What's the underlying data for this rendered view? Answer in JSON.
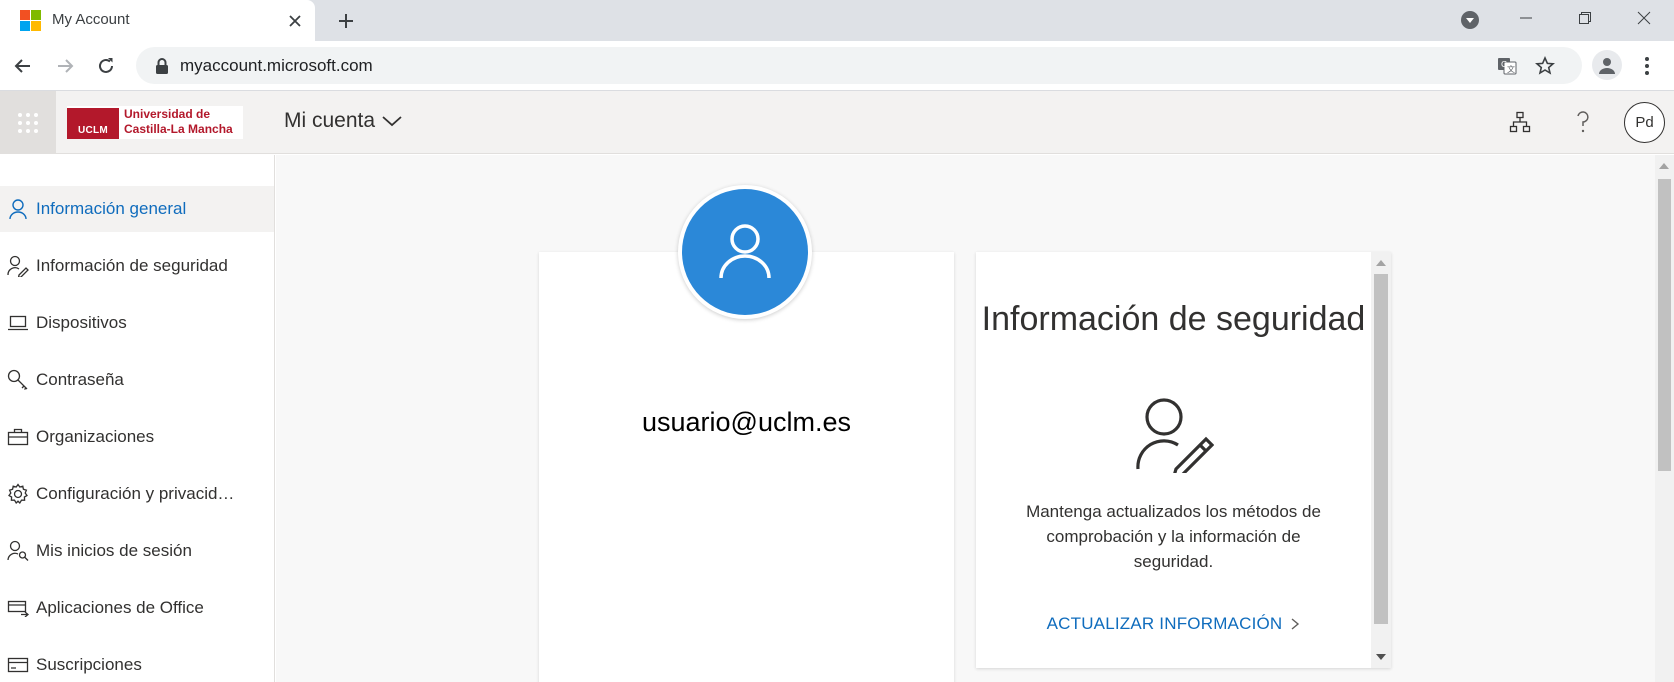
{
  "browser": {
    "tab_title": "My Account",
    "url": "myaccount.microsoft.com"
  },
  "header": {
    "logo_badge": "UCLM",
    "logo_line1": "Universidad de",
    "logo_line2": "Castilla-La Mancha",
    "app_title": "Mi cuenta",
    "avatar_initials": "Pd"
  },
  "sidebar": {
    "items": [
      {
        "label": "Información general",
        "icon": "person-icon",
        "selected": true
      },
      {
        "label": "Información de seguridad",
        "icon": "person-edit-icon"
      },
      {
        "label": "Dispositivos",
        "icon": "laptop-icon"
      },
      {
        "label": "Contraseña",
        "icon": "key-icon"
      },
      {
        "label": "Organizaciones",
        "icon": "briefcase-icon"
      },
      {
        "label": "Configuración y privacidad",
        "icon": "gear-icon"
      },
      {
        "label": "Mis inicios de sesión",
        "icon": "person-key-icon"
      },
      {
        "label": "Aplicaciones de Office",
        "icon": "office-apps-icon"
      },
      {
        "label": "Suscripciones",
        "icon": "card-icon"
      }
    ]
  },
  "profile_card": {
    "email": "usuario@uclm.es"
  },
  "security_card": {
    "title": "Información de seguridad",
    "description": "Mantenga actualizados los métodos de comprobación y la información de seguridad.",
    "link_label": "ACTUALIZAR INFORMACIÓN"
  },
  "colors": {
    "accent": "#0f6cbd",
    "avatar_blue": "#2b88d8",
    "uclm_red": "#b3182b"
  }
}
